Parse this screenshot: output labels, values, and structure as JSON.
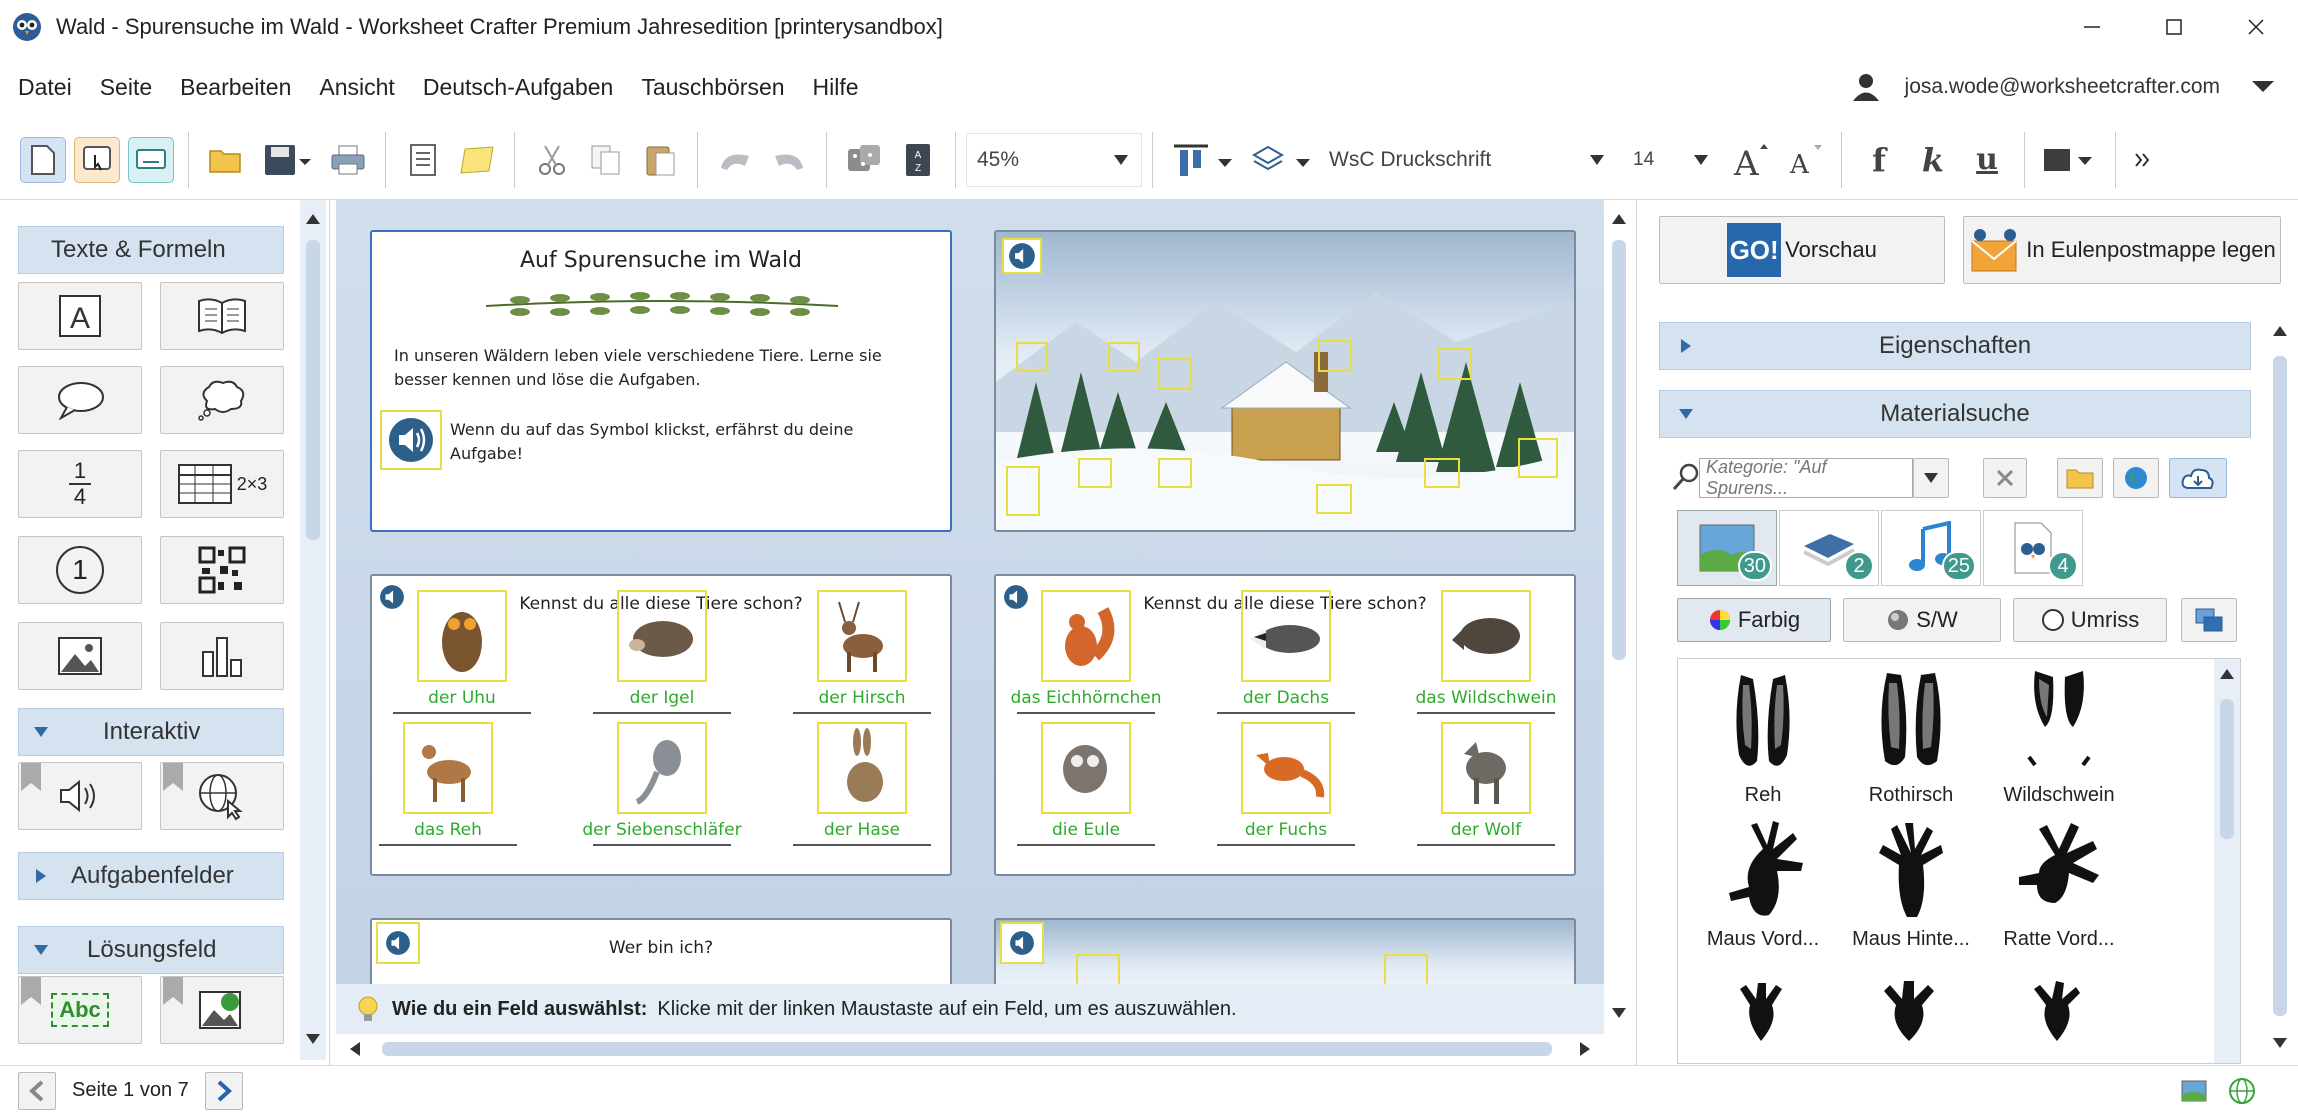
{
  "window": {
    "title": "Wald - Spurensuche im Wald  - Worksheet Crafter Premium Jahresedition [printerysandbox]"
  },
  "menu": [
    "Datei",
    "Seite",
    "Bearbeiten",
    "Ansicht",
    "Deutsch-Aufgaben",
    "Tauschbörsen",
    "Hilfe"
  ],
  "user": {
    "email": "josa.wode@worksheetcrafter.com"
  },
  "toolbar": {
    "zoom": "45%",
    "font": "WsC Druckschrift",
    "size": "14",
    "bold_label": "f",
    "italic_label": "k",
    "underline_label": "u"
  },
  "left_panel": {
    "texte_header": "Texte & Formeln",
    "fraction_top": "1",
    "fraction_bottom": "4",
    "table_label": "2×3",
    "circle_label": "1",
    "interaktiv_header": "Interaktiv",
    "aufgaben_header": "Aufgabenfelder",
    "loesung_header": "Lösungsfeld",
    "abc_label": "Abc"
  },
  "worksheet": {
    "title": "Auf Spurensuche im Wald",
    "intro": "In unseren Wäldern leben viele verschiedene Tiere. Lerne sie besser kennen und löse die Aufgaben.",
    "audio_hint": "Wenn du auf das Symbol klickst, erfährst du deine Aufgabe!",
    "question": "Kennst du alle diese Tiere schon?",
    "animals_a": [
      "der Uhu",
      "der Igel",
      "der Hirsch",
      "das Reh",
      "der Siebenschläfer",
      "der Hase"
    ],
    "animals_b": [
      "das Eichhörnchen",
      "der Dachs",
      "das Wildschwein",
      "die Eule",
      "der Fuchs",
      "der Wolf"
    ],
    "riddle": "Wer bin ich?"
  },
  "hint": {
    "bold": "Wie du ein Feld auswählst:",
    "text": "Klicke mit der linken Maustaste auf ein Feld, um es auszuwählen."
  },
  "right_panel": {
    "preview_label": "Vorschau",
    "go_label": "GO!",
    "mailbox_label": "In Eulenpostmappe legen",
    "properties_header": "Eigenschaften",
    "search_header": "Materialsuche",
    "category_placeholder": "Kategorie: \"Auf Spurens...",
    "tab_counts": [
      "30",
      "2",
      "25",
      "4"
    ],
    "filter_color": "Farbig",
    "filter_bw": "S/W",
    "filter_outline": "Umriss",
    "results": [
      "Reh",
      "Rothirsch",
      "Wildschwein",
      "Maus Vord...",
      "Maus Hinte...",
      "Ratte Vord..."
    ]
  },
  "status": {
    "page": "Seite 1 von 7"
  }
}
